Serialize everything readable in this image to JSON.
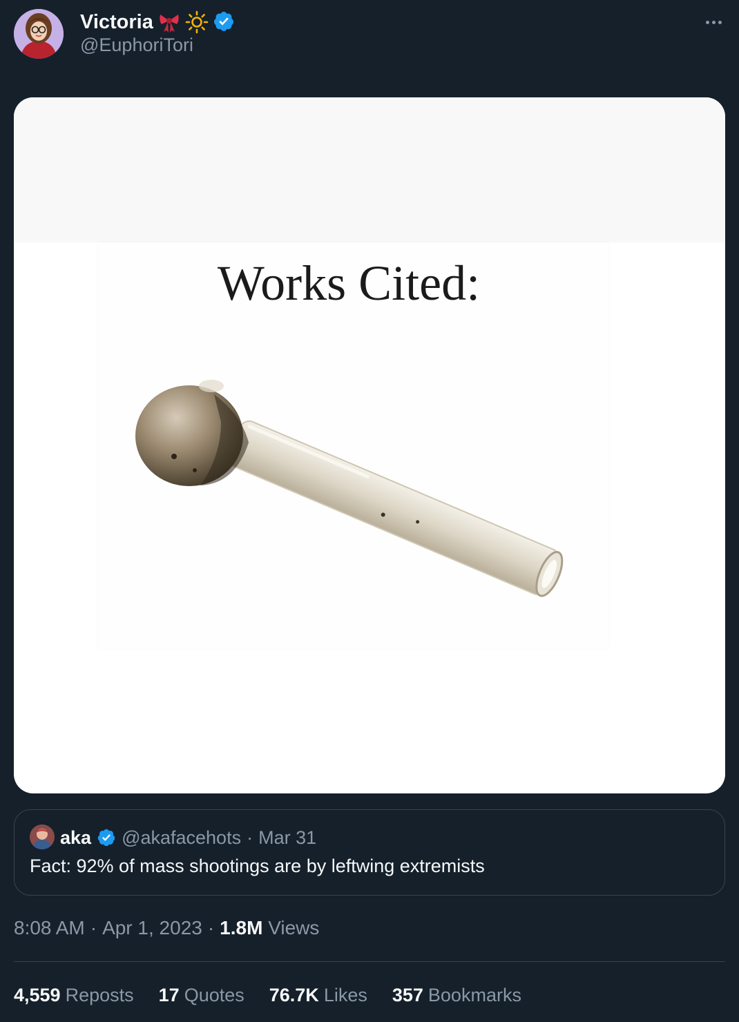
{
  "colors": {
    "background": "#15202b",
    "primary_text": "#f7f9f9",
    "secondary_text": "#8b98a5",
    "border": "#38444d",
    "verified": "#1d9bf0"
  },
  "author": {
    "name": "Victoria",
    "handle": "@EuphoriTori",
    "emojis": [
      "ribbon-emoji",
      "sun-emoji"
    ],
    "verified": true
  },
  "media": {
    "caption": "Works Cited:",
    "image_subject": "glass-pipe-image"
  },
  "quoted_tweet": {
    "name": "aka",
    "verified": true,
    "handle": "@akafacehots",
    "separator": "·",
    "date": "Mar 31",
    "text": "Fact: 92% of mass shootings are by leftwing extremists"
  },
  "meta": {
    "time": "8:08 AM",
    "sep1": "·",
    "date": "Apr 1, 2023",
    "sep2": "·",
    "views_count": "1.8M",
    "views_label": "Views"
  },
  "stats": {
    "reposts_count": "4,559",
    "reposts_label": "Reposts",
    "quotes_count": "17",
    "quotes_label": "Quotes",
    "likes_count": "76.7K",
    "likes_label": "Likes",
    "bookmarks_count": "357",
    "bookmarks_label": "Bookmarks"
  }
}
